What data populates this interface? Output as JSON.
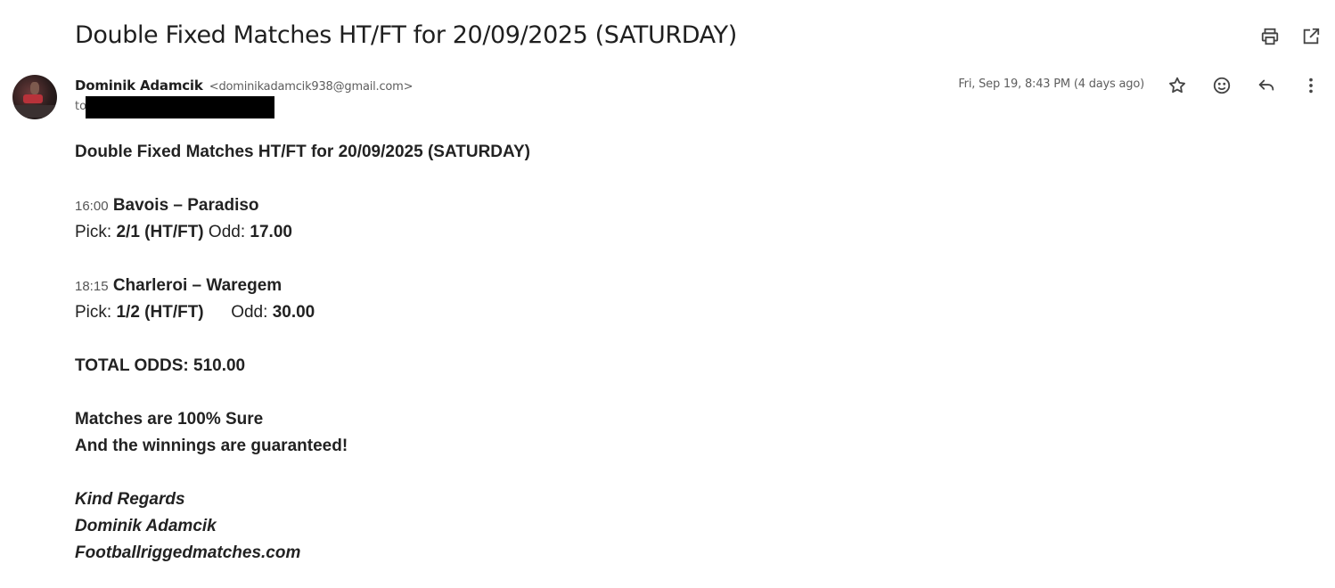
{
  "subject": "Double Fixed Matches HT/FT for 20/09/2025 (SATURDAY)",
  "header_icons": [
    "print-icon",
    "open-in-new-window-icon"
  ],
  "sender": {
    "name": "Dominik Adamcik",
    "email": "<dominikadamcik938@gmail.com>",
    "to_label": "to"
  },
  "date": "Fri, Sep 19, 8:43 PM (4 days ago)",
  "message_icons": [
    "star-icon",
    "emoji-reaction-icon",
    "reply-icon",
    "more-options-icon"
  ],
  "body": {
    "heading": "Double Fixed Matches HT/FT for 20/09/2025 (SATURDAY)",
    "matches": [
      {
        "time": "16:00",
        "teams": "Bavois – Paradiso",
        "pick_label": "Pick:",
        "pick": "2/1 (HT/FT)",
        "odd_label": "Odd:",
        "odd": "17.00"
      },
      {
        "time": "18:15",
        "teams": "Charleroi – Waregem",
        "pick_label": "Pick:",
        "pick": "1/2 (HT/FT)",
        "odd_label": "Odd:",
        "odd": "30.00"
      }
    ],
    "total": "TOTAL ODDS: 510.00",
    "sure_line": "Matches are 100% Sure",
    "guarantee_line": "And the winnings are guaranteed!",
    "signature": [
      "Kind Regards",
      "Dominik Adamcik",
      "Footballriggedmatches.com"
    ]
  }
}
